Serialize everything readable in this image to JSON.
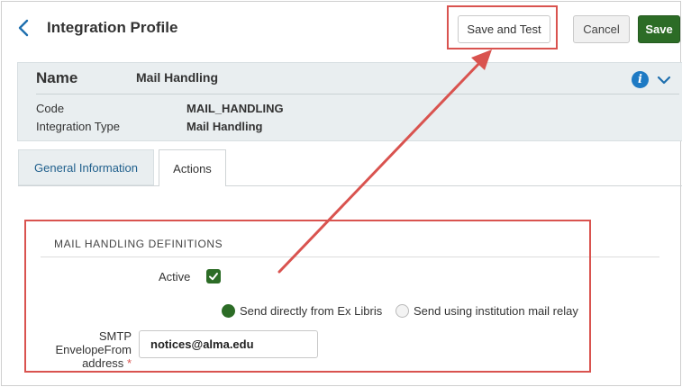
{
  "header": {
    "title": "Integration Profile",
    "buttons": {
      "save_and_test": "Save and Test",
      "cancel": "Cancel",
      "save": "Save"
    }
  },
  "summary": {
    "name_label": "Name",
    "name_value": "Mail Handling",
    "rows": [
      {
        "label": "Code",
        "value": "MAIL_HANDLING"
      },
      {
        "label": "Integration Type",
        "value": "Mail Handling"
      }
    ]
  },
  "tabs": [
    {
      "label": "General Information",
      "active": false
    },
    {
      "label": "Actions",
      "active": true
    }
  ],
  "section": {
    "title": "MAIL HANDLING DEFINITIONS",
    "active_label": "Active",
    "active_checked": true,
    "radio_options": [
      {
        "label": "Send directly from Ex Libris",
        "selected": true
      },
      {
        "label": "Send using institution mail relay",
        "selected": false
      }
    ],
    "smtp_label_line1": "SMTP",
    "smtp_label_line2": "EnvelopeFrom",
    "smtp_label_line3": "address",
    "required_mark": "*",
    "smtp_value": "notices@alma.edu"
  },
  "icons": {
    "back": "chevron-left-icon",
    "info": "info-icon",
    "expand": "chevron-down-icon",
    "check": "checkmark-icon"
  },
  "colors": {
    "primary_green": "#2c6c26",
    "link_blue": "#1f5f8c",
    "info_blue": "#1e7ac4",
    "annotation_red": "#d9534f",
    "summary_bg": "#e9eef0"
  }
}
